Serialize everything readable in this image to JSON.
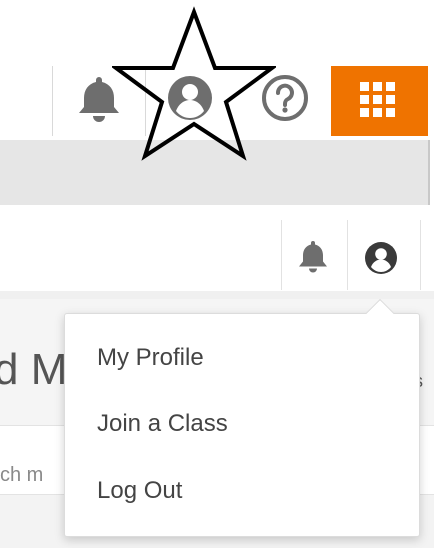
{
  "top_header": {
    "icons": [
      "bell-icon",
      "user-icon",
      "help-icon",
      "apps-grid-icon"
    ],
    "apps_color": "#ef7300",
    "star_annotation": "star-outline"
  },
  "header": {
    "icons": [
      "bell-icon",
      "user-icon"
    ]
  },
  "background_fragments": {
    "section_title": "d M",
    "right_fragment": "s",
    "search_fragment": "ch m"
  },
  "user_menu": {
    "items": [
      {
        "label": "My Profile"
      },
      {
        "label": "Join a Class"
      },
      {
        "label": "Log Out"
      }
    ]
  },
  "colors": {
    "accent": "#ef7300",
    "icon": "#6e6e6e",
    "icon_dark": "#3a3a3a",
    "menu_text": "#444444"
  }
}
